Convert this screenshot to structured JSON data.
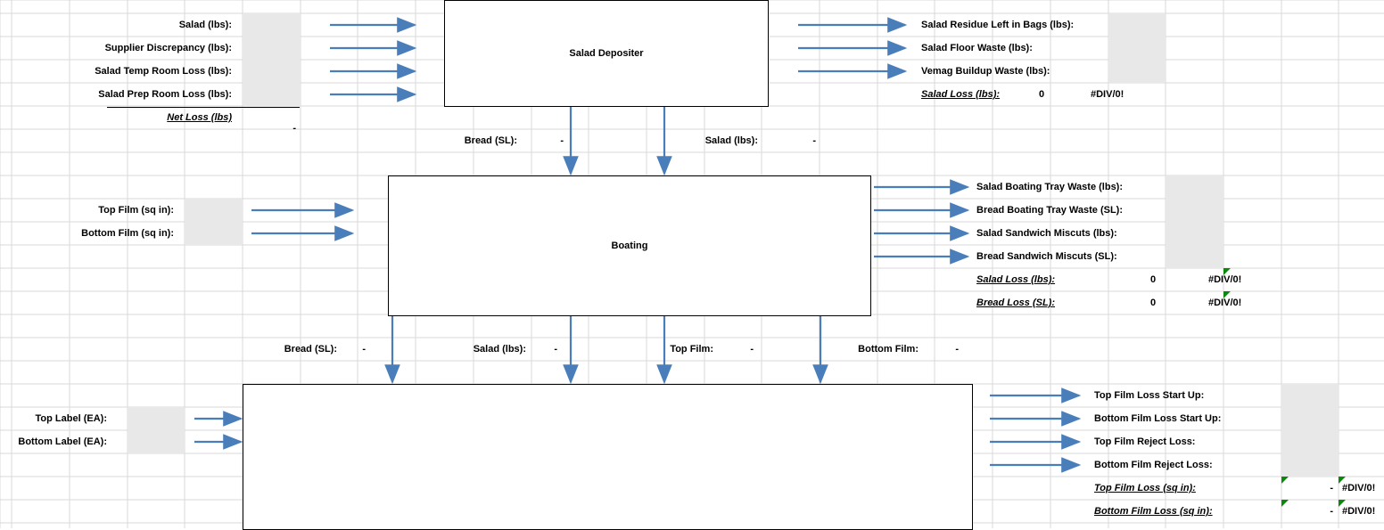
{
  "process": {
    "box1": "Salad Depositer",
    "box2": "Boating",
    "box3": ""
  },
  "inputs_box1": {
    "salad": "Salad (lbs):",
    "supplier_disc": "Supplier Discrepancy (lbs):",
    "temp_room": "Salad Temp Room Loss (lbs):",
    "prep_room": "Salad Prep Room Loss (lbs):",
    "net_loss": "Net Loss (lbs)",
    "net_loss_val": "-"
  },
  "outputs_box1": {
    "residue": "Salad Residue Left in Bags (lbs):",
    "floor": "Salad Floor Waste (lbs):",
    "vemag": "Vemag Buildup Waste (lbs):",
    "loss_label": "Salad Loss (lbs):",
    "loss_val": "0",
    "loss_err": "#DIV/0!"
  },
  "flows_1_2": {
    "bread": "Bread (SL):",
    "bread_val": "-",
    "salad": "Salad (lbs):",
    "salad_val": "-"
  },
  "inputs_box2": {
    "top_film": "Top Film (sq in):",
    "bottom_film": "Bottom Film (sq in):"
  },
  "outputs_box2": {
    "salad_tray": "Salad Boating Tray Waste (lbs):",
    "bread_tray": "Bread Boating Tray Waste (SL):",
    "salad_miscut": "Salad Sandwich Miscuts (lbs):",
    "bread_miscut": "Bread Sandwich Miscuts (SL):",
    "salad_loss_label": "Salad Loss (lbs):",
    "salad_loss_val": "0",
    "salad_loss_err": "#DIV/0!",
    "bread_loss_label": "Bread Loss (SL):",
    "bread_loss_val": "0",
    "bread_loss_err": "#DIV/0!"
  },
  "flows_2_3": {
    "bread": "Bread (SL):",
    "bread_val": "-",
    "salad": "Salad (lbs):",
    "salad_val": "-",
    "top_film": "Top Film:",
    "top_film_val": "-",
    "bottom_film": "Bottom Film:",
    "bottom_film_val": "-"
  },
  "inputs_box3": {
    "top_label": "Top Label (EA):",
    "bottom_label": "Bottom Label (EA):"
  },
  "outputs_box3": {
    "top_start": "Top Film Loss Start Up:",
    "bottom_start": "Bottom Film Loss Start Up:",
    "top_reject": "Top Film Reject Loss:",
    "bottom_reject": "Bottom Film Reject Loss:",
    "top_loss_label": "Top Film Loss (sq in):",
    "top_loss_val": "-",
    "top_loss_err": "#DIV/0!",
    "bottom_loss_label": "Bottom Film Loss (sq in):",
    "bottom_loss_val": "-",
    "bottom_loss_err": "#DIV/0!"
  }
}
